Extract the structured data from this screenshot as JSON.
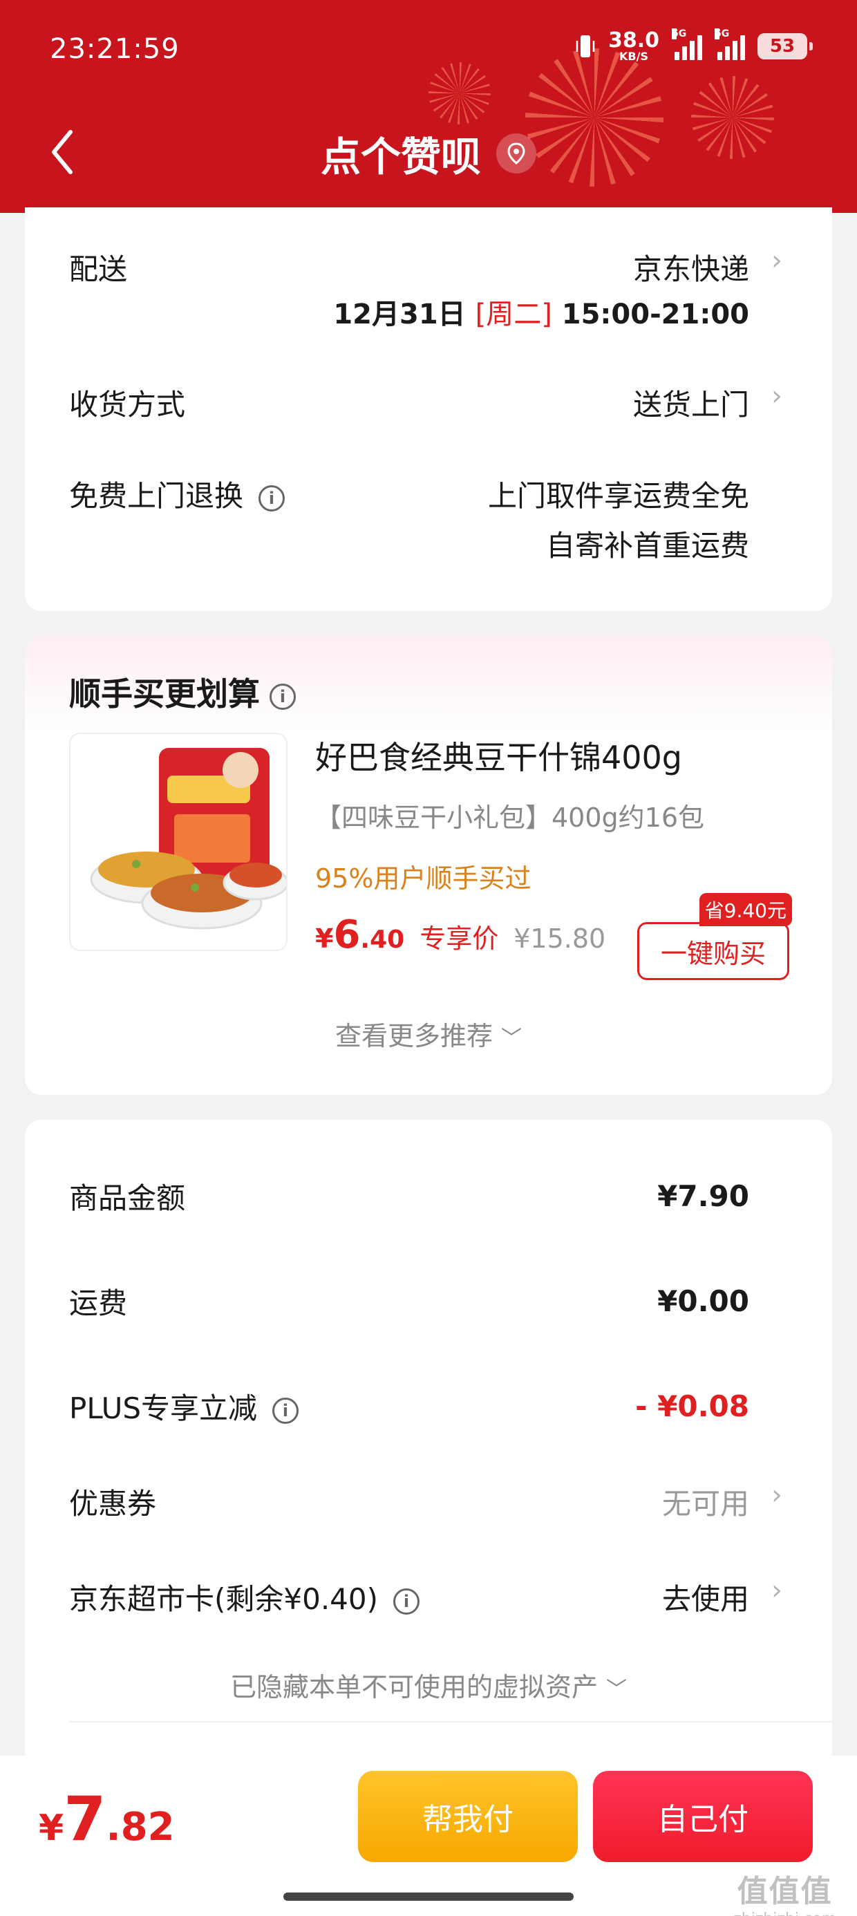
{
  "status": {
    "time": "23:21:59",
    "net_speed": "38.0",
    "net_unit": "KB/S",
    "signal1": "5G",
    "signal2": "5G",
    "battery": "53"
  },
  "header": {
    "title": "点个赞呗",
    "back_icon": "back-arrow-icon",
    "location_icon": "location-pin-icon"
  },
  "delivery": {
    "label": "配送",
    "carrier": "京东快递",
    "date": "12月31日",
    "weekday": "[周二]",
    "time_slot": "15:00-21:00",
    "method_label": "收货方式",
    "method_value": "送货上门",
    "return_label": "免费上门退换",
    "return_line1": "上门取件享运费全免",
    "return_line2": "自寄补首重运费"
  },
  "recommend": {
    "title": "顺手买更划算",
    "product_name": "好巴食经典豆干什锦400g",
    "product_spec": "【四味豆干小礼包】400g约16包",
    "bought_text": "95%用户顺手买过",
    "price_currency": "¥",
    "price_int": "6",
    "price_dec": ".40",
    "price_tag": "专享价",
    "price_old": "¥15.80",
    "save_badge": "省9.40元",
    "buy_button": "一键购买",
    "more_text": "查看更多推荐"
  },
  "summary": {
    "goods_label": "商品金额",
    "goods_value": "¥7.90",
    "shipping_label": "运费",
    "shipping_value": "¥0.00",
    "plus_label": "PLUS专享立减",
    "plus_value": "- ¥0.08",
    "coupon_label": "优惠券",
    "coupon_value": "无可用",
    "card_label": "京东超市卡(剩余¥0.40)",
    "card_value": "去使用",
    "hidden_text": "已隐藏本单不可使用的虚拟资产"
  },
  "bottom": {
    "total_currency": "¥",
    "total_int": "7",
    "total_dec": ".82",
    "help_pay": "帮我付",
    "self_pay": "自己付"
  },
  "watermark": {
    "line1": "值值值",
    "line2": "zhizhizhi.com"
  },
  "colors": {
    "header_red": "#c8141c",
    "price_red": "#e02020",
    "help_yellow": "#ffc42a",
    "self_red": "#f01c2c"
  }
}
